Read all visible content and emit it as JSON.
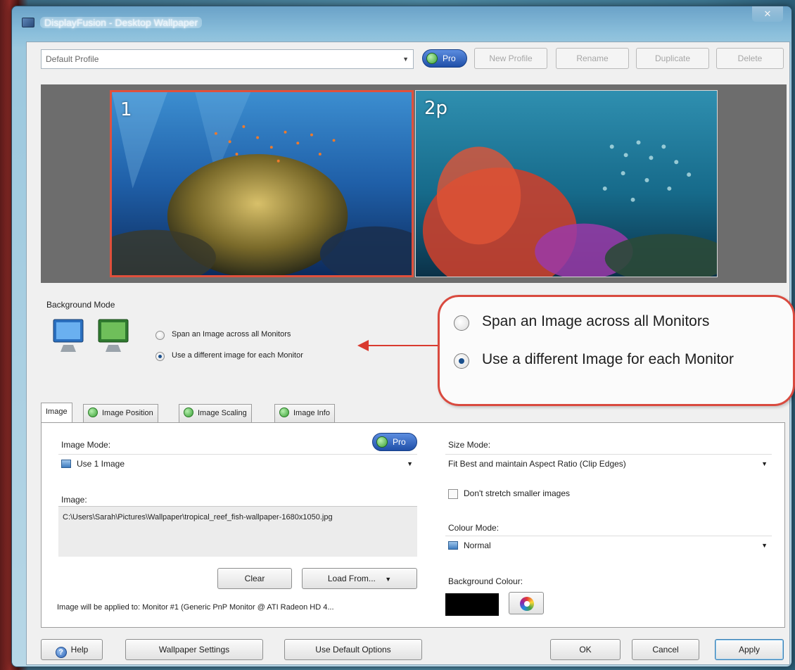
{
  "window": {
    "title": "DisplayFusion - Desktop Wallpaper",
    "close_glyph": "✕"
  },
  "toolbar": {
    "profile_value": "Default Profile",
    "pro_label": "Pro",
    "new_profile": "New Profile",
    "rename": "Rename",
    "duplicate": "Duplicate",
    "delete": "Delete"
  },
  "monitors": [
    {
      "label": "1",
      "selected": true
    },
    {
      "label": "2p",
      "selected": false
    }
  ],
  "background_mode": {
    "label": "Background Mode",
    "options": [
      {
        "label": "Span an Image across all Monitors",
        "checked": false
      },
      {
        "label": "Use a different image for each Monitor",
        "checked": true
      }
    ]
  },
  "callout": {
    "options": [
      {
        "label": "Span an Image across all Monitors",
        "checked": false
      },
      {
        "label": "Use a different Image for each Monitor",
        "checked": true
      }
    ],
    "accent": "#d94a3f"
  },
  "tabs": [
    {
      "label": "Image",
      "active": true
    },
    {
      "label": "Image Position",
      "active": false
    },
    {
      "label": "Image Scaling",
      "active": false
    },
    {
      "label": "Image Info",
      "active": false
    }
  ],
  "image_panel": {
    "image_mode_label": "Image Mode:",
    "pro_label": "Pro",
    "image_mode_value": "Use 1 Image",
    "image_label": "Image:",
    "image_path": "C:\\Users\\Sarah\\Pictures\\Wallpaper\\tropical_reef_fish-wallpaper-1680x1050.jpg",
    "clear": "Clear",
    "load_from": "Load From...",
    "applied_to": "Image will be applied to: Monitor #1 (Generic PnP Monitor @ ATI Radeon HD 4..."
  },
  "settings_panel": {
    "size_mode_label": "Size Mode:",
    "size_mode_value": "Fit Best and maintain Aspect Ratio (Clip Edges)",
    "dont_stretch": "Don't stretch smaller images",
    "colour_mode_label": "Colour Mode:",
    "colour_mode_value": "Normal",
    "background_colour_label": "Background Colour:",
    "background_colour": "#000000"
  },
  "footer": {
    "help": "Help",
    "wallpaper_settings": "Wallpaper Settings",
    "use_default_options": "Use Default Options",
    "ok": "OK",
    "cancel": "Cancel",
    "apply": "Apply"
  }
}
